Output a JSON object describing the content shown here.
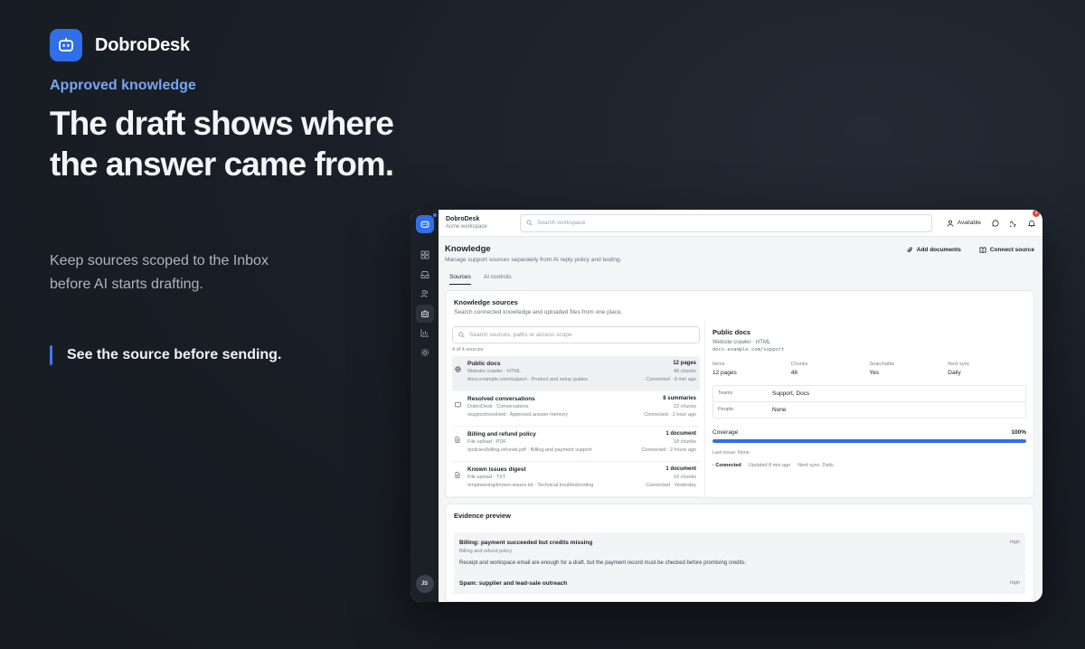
{
  "hero": {
    "brand": "DobroDesk",
    "eyebrow": "Approved knowledge",
    "headline_line1": "The draft shows where",
    "headline_line2": "the answer came from.",
    "subtext_line1": "Keep sources scoped to the Inbox",
    "subtext_line2": "before AI starts drafting.",
    "callout": "See the source before sending."
  },
  "colors": {
    "accent": "#2f6fe8",
    "eyebrow": "#79a5f2",
    "rail": "#1b1f26",
    "badge": "#e34545"
  },
  "rail": {
    "items": [
      {
        "icon": "dashboard-icon"
      },
      {
        "icon": "inbox-icon"
      },
      {
        "icon": "contacts-icon"
      },
      {
        "icon": "bot-icon",
        "active": true
      },
      {
        "icon": "reports-icon"
      },
      {
        "icon": "settings-icon"
      }
    ],
    "avatar": "JS"
  },
  "topbar": {
    "workspace_name": "DobroDesk",
    "workspace_sub": "Acme workspace",
    "search_placeholder": "Search workspace",
    "status": "Available",
    "notifications": "4"
  },
  "page": {
    "title": "Knowledge",
    "subtitle": "Manage support sources separately from AI reply policy and testing.",
    "add_documents": "Add documents",
    "connect_source": "Connect source",
    "tabs": [
      "Sources",
      "AI controls"
    ]
  },
  "sources_card": {
    "title": "Knowledge sources",
    "subtitle": "Search connected knowledge and uploaded files from one place.",
    "search_placeholder": "Search sources, paths or access scope",
    "count": "4 of 4 sources",
    "items": [
      {
        "name": "Public docs",
        "type": "Website crawler · HTML",
        "path": "docs.example.com/support · Product and setup guides",
        "count": "12 pages",
        "chunks": "48 chunks",
        "status": "· Connected · 8 min ago",
        "icon": "globe-icon"
      },
      {
        "name": "Resolved conversations",
        "type": "DobroDesk · Conversations",
        "path": "/support/resolved · Approved answer memory",
        "count": "8 summaries",
        "chunks": "22 chunks",
        "status": "Connected · 1 hour ago",
        "icon": "book-icon"
      },
      {
        "name": "Billing and refund policy",
        "type": "File upload · PDF",
        "path": "/policies/billing-refunds.pdf · Billing and payment support",
        "count": "1 document",
        "chunks": "18 chunks",
        "status": "Connected · 2 hours ago",
        "icon": "file-icon"
      },
      {
        "name": "Known issues digest",
        "type": "File upload · TXT",
        "path": "/engineering/known-issues.txt · Technical troubleshooting",
        "count": "1 document",
        "chunks": "16 chunks",
        "status": "· Connected · Yesterday",
        "icon": "file-icon"
      }
    ]
  },
  "detail": {
    "title": "Public docs",
    "meta": "Website crawler · HTML",
    "url": "docs.example.com/support",
    "stats": [
      {
        "k": "Items",
        "v": "12 pages"
      },
      {
        "k": "Chunks",
        "v": "48"
      },
      {
        "k": "Searchable",
        "v": "Yes"
      },
      {
        "k": "Next sync",
        "v": "Daily"
      }
    ],
    "teams_k": "Teams",
    "teams_v": "Support, Docs",
    "people_k": "People",
    "people_v": "None",
    "coverage_k": "Coverage",
    "coverage_v": "100%",
    "coverage_fraction": 1.0,
    "last_issue": "Last issue: None",
    "connected": "· Connected",
    "updated": "Updated 8 min ago",
    "next_sync": "Next sync: Daily"
  },
  "evidence": {
    "title": "Evidence preview",
    "items": [
      {
        "title": "Billing: payment succeeded but credits missing",
        "source": "Billing and refund policy",
        "priority": "High",
        "text": "Receipt and workspace email are enough for a draft, but the payment record must be checked before promising credits."
      },
      {
        "title": "Spam: supplier and lead-sale outreach",
        "priority": "High"
      }
    ]
  }
}
